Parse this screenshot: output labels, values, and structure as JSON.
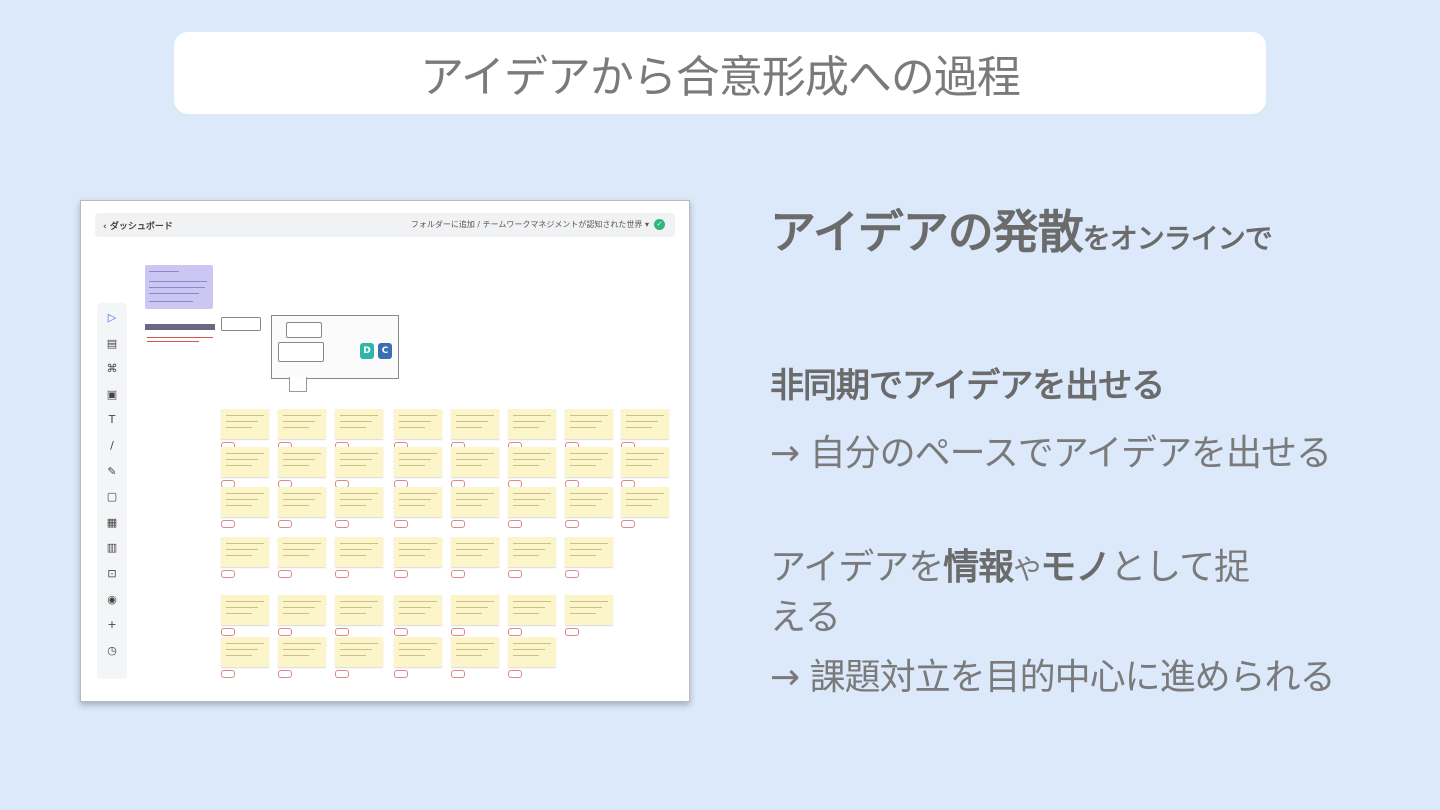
{
  "slide": {
    "title": "アイデアから合意形成への過程"
  },
  "screenshot": {
    "back_label": "‹ ダッシュボード",
    "breadcrumb": "フォルダーに追加 / チームワークマネジメントが認知された世界 ▾",
    "tag_d": "D",
    "tag_c": "C",
    "tools": [
      "select-icon",
      "note-icon",
      "shapes-icon",
      "image-icon",
      "text-icon",
      "line-icon",
      "pen-icon",
      "sticky-icon",
      "table-icon",
      "kanban-icon",
      "frame-icon",
      "location-icon",
      "plus-icon",
      "timer-icon"
    ],
    "tool_glyphs": [
      "▷",
      "▤",
      "⌘",
      "▣",
      "T",
      "/",
      "✎",
      "▢",
      "▦",
      "▥",
      "⊡",
      "◉",
      "+",
      "◷"
    ]
  },
  "bullets": {
    "heading_bold": "アイデアの発散",
    "heading_small": "をオンラインで",
    "point1_title": "非同期でアイデアを出せる",
    "point1_detail": "→ 自分のペースでアイデアを出せる",
    "point2_a": "アイデアを",
    "point2_b": "情報",
    "point2_c": "や",
    "point2_d": "モノ",
    "point2_e": "として捉",
    "point2_wrap": "える",
    "point2_detail": "→ 課題対立を目的中心に進められる"
  }
}
